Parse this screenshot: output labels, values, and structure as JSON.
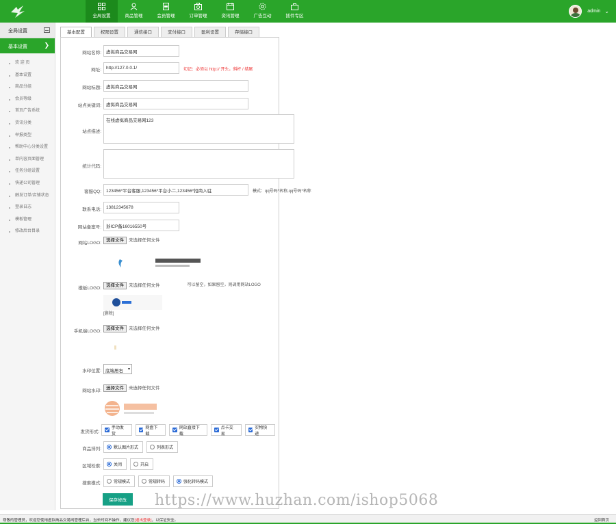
{
  "nav": {
    "items": [
      {
        "label": "全局设置",
        "icon": "grid-icon"
      },
      {
        "label": "商品管理",
        "icon": "user-icon"
      },
      {
        "label": "会员管理",
        "icon": "document-icon"
      },
      {
        "label": "订单管理",
        "icon": "camera-icon"
      },
      {
        "label": "资讯管理",
        "icon": "calendar-icon"
      },
      {
        "label": "广告互动",
        "icon": "gear-icon"
      },
      {
        "label": "插件专区",
        "icon": "bag-icon"
      }
    ],
    "user": "admin"
  },
  "sidebar": {
    "title": "全局设置",
    "active": "基本设置",
    "items": [
      "欢 迎 页",
      "基本设置",
      "商品分组",
      "会员等级",
      "首页广告系统",
      "资讯分类",
      "举报类型",
      "帮助中心分类设置",
      "单内容页面管理",
      "任务分组设置",
      "快递公司管理",
      "触发订单/店铺状态",
      "登录日志",
      "模板管理",
      "修改后台目录"
    ]
  },
  "tabs": [
    "基本配置",
    "权限设置",
    "通信接口",
    "支付接口",
    "盈利设置",
    "存储接口"
  ],
  "form": {
    "site_name_label": "网站名称:",
    "site_name": "虚拟商品交易网",
    "url_label": "网址:",
    "url": "http://127.0.0.1/",
    "url_hint": "切记：必须以 http:// 开头，斜杆 / 结尾",
    "title_label": "网站标题:",
    "title": "虚拟商品交易网",
    "keywords_label": "站点关键词:",
    "keywords": "虚拟商品交易网",
    "description_label": "站点描述:",
    "description": "在线虚拟商品交易网123",
    "stats_label": "统计代码:",
    "stats": "",
    "qq_label": "客服QQ:",
    "qq": "123456*平台客服,123456*平台小二,123456*招商入驻",
    "qq_hint": "模式：qq号码*名称,qq号码*名称",
    "phone_label": "联系电话:",
    "phone": "13812345678",
    "icp_label": "网站备案号:",
    "icp": "浙ICP备16016550号",
    "logo_label": "网站LOGO:",
    "template_logo_label": "模板LOGO:",
    "template_logo_hint": "可以留空，如果留空，则调用网站LOGO",
    "delete_label": "[删除]",
    "mobile_logo_label": "手机端LOGO:",
    "watermark_pos_label": "水印位置:",
    "watermark_pos": "底端居右",
    "watermark_label": "网站水印:",
    "file_button": "选择文件",
    "file_none": "未选择任何文件",
    "delivery_label": "发货形式:",
    "delivery": [
      "手动发货",
      "网盘下载",
      "网站直接下载",
      "点卡交易",
      "实物快递"
    ],
    "layout_label": "商品排列:",
    "layout": [
      "默认图片形式",
      "列表形式"
    ],
    "region_label": "区域检索:",
    "region": [
      "关闭",
      "开启"
    ],
    "search_label": "搜索模式:",
    "search": [
      "常规模式",
      "常规转码",
      "强化转码模式"
    ],
    "save": "保存修改"
  },
  "footer": {
    "text_before": "尊敬的管理员，欢迎您使用虚拟商品交易网管理后台，当长时间不操作，建议您",
    "link": "[退出登录]",
    "text_after": "，以保证安全。",
    "right": "返回首页"
  },
  "watermark_text": "https://www.huzhan.com/ishop5068",
  "colors": {
    "brand": "#2aa52a",
    "save": "#16a085",
    "hint_red": "#e33333"
  }
}
